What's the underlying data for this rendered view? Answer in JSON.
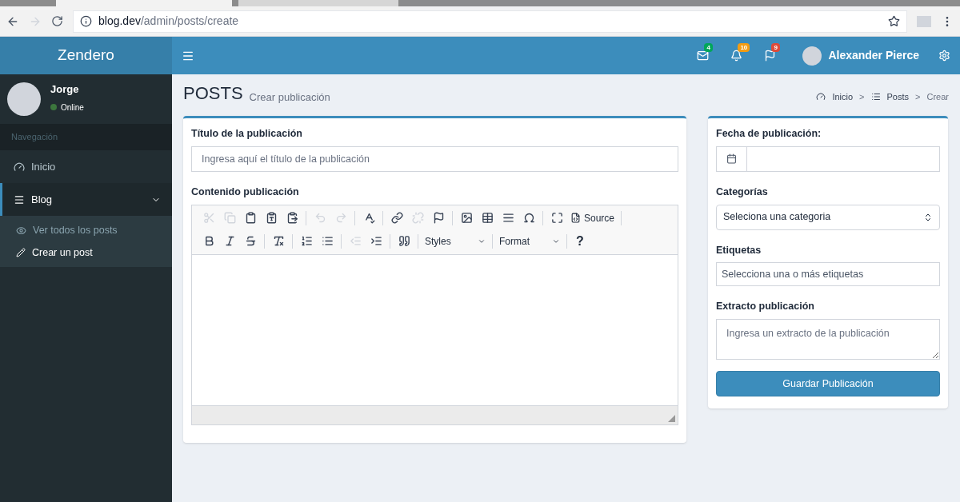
{
  "browser": {
    "url_host": "blog.dev",
    "url_path": "/admin/posts/create"
  },
  "header": {
    "logo": "Zendero",
    "notifications": [
      {
        "count": "4",
        "color": "#00a65a"
      },
      {
        "count": "10",
        "color": "#f39c12"
      },
      {
        "count": "9",
        "color": "#dd4b39"
      }
    ],
    "user_name": "Alexander Pierce"
  },
  "sidebar": {
    "user": {
      "name": "Jorge",
      "status": "Online"
    },
    "section": "Navegación",
    "items": [
      {
        "label": "Inicio",
        "expanded": false
      },
      {
        "label": "Blog",
        "expanded": true,
        "children": [
          {
            "label": "Ver todos los posts",
            "selected": false
          },
          {
            "label": "Crear un post",
            "selected": true
          }
        ]
      }
    ]
  },
  "page": {
    "title": "POSTS",
    "subtitle": "Crear publicación",
    "breadcrumbs": [
      "Inicio",
      "Posts",
      "Crear"
    ],
    "breadcrumb_separator": ">"
  },
  "main_form": {
    "title_label": "Título de la publicación",
    "title_placeholder": "Ingresa aquí el título de la publicación",
    "content_label": "Contenido publicación",
    "toolbar": {
      "row_1": [
        {
          "disabled": true
        },
        {
          "disabled": true
        },
        {
          "disabled": false
        },
        {
          "disabled": false
        },
        {
          "disabled": false
        },
        {
          "disabled": true
        },
        {
          "disabled": true
        },
        {
          "disabled": false
        },
        {
          "disabled": false
        },
        {
          "disabled": true
        },
        {
          "disabled": false
        },
        {
          "disabled": false
        },
        {
          "disabled": false
        },
        {
          "disabled": false
        },
        {
          "disabled": false
        },
        {
          "disabled": false
        }
      ],
      "source_label": "Source",
      "row_2": [
        {
          "disabled": false
        },
        {
          "disabled": false
        },
        {
          "disabled": false
        },
        {
          "disabled": false
        },
        {
          "disabled": false
        },
        {
          "disabled": false
        },
        {
          "disabled": true
        },
        {
          "disabled": false
        },
        {
          "disabled": false
        }
      ],
      "styles_label": "Styles",
      "format_label": "Format",
      "help_label": "?"
    }
  },
  "side_form": {
    "date_label": "Fecha de publicación:",
    "categories_label": "Categorías",
    "categories_value": "Seleciona una categoria",
    "tags_label": "Etiquetas",
    "tags_placeholder": "Selecciona una o más etiquetas",
    "excerpt_label": "Extracto publicación",
    "excerpt_placeholder": "Ingresa un extracto de la publicación",
    "save_button": "Guardar Publicación"
  }
}
